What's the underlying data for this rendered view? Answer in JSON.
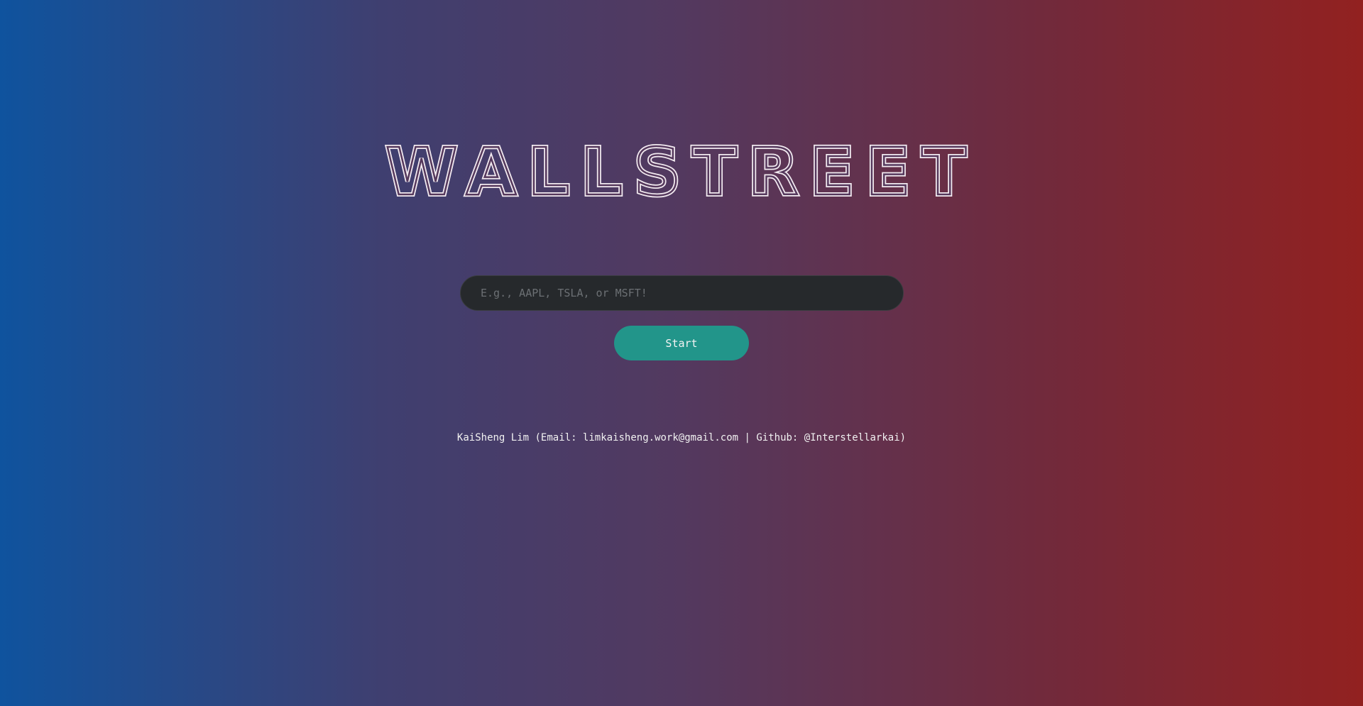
{
  "logo": {
    "text": "WALLSTREET"
  },
  "search": {
    "placeholder": "E.g., AAPL, TSLA, or MSFT!",
    "value": ""
  },
  "start_button": {
    "label": "Start"
  },
  "footer": {
    "text": "KaiSheng Lim (Email: limkaisheng.work@gmail.com | Github: @Interstellarkai)"
  },
  "colors": {
    "gradient_left": "#0f539e",
    "gradient_right": "#922120",
    "search_background": "#26292c",
    "button_background": "#22958a"
  }
}
